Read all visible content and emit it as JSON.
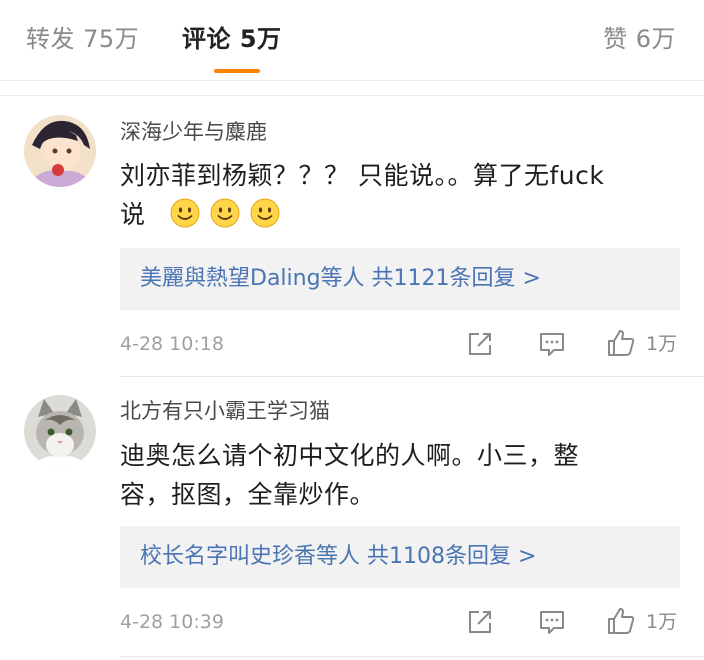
{
  "tabs": {
    "repost": "转发 75万",
    "comments": "评论 5万",
    "likes": "赞 6万"
  },
  "comments": [
    {
      "username": "深海少年与麋鹿",
      "line1": "刘亦菲到杨颖？？？ 只能说。。算了无fuck",
      "line2": "说",
      "emoji": [
        "smile-emoji",
        "smile-emoji",
        "smile-emoji"
      ],
      "reply_summary": "美麗與熱望Daling等人  共1121条回复 >",
      "time": "4-28 10:18",
      "likes": "1万"
    },
    {
      "username": "北方有只小霸王学习猫",
      "line1": "迪奥怎么请个初中文化的人啊。小三，整",
      "line2": "容，抠图，全靠炒作。",
      "reply_summary": "校长名字叫史珍香等人  共1108条回复 >",
      "time": "4-28 10:39",
      "likes": "1万"
    }
  ],
  "colors": {
    "accent": "#ff8200",
    "link": "#4a74b3",
    "muted": "#a0a0a0"
  }
}
